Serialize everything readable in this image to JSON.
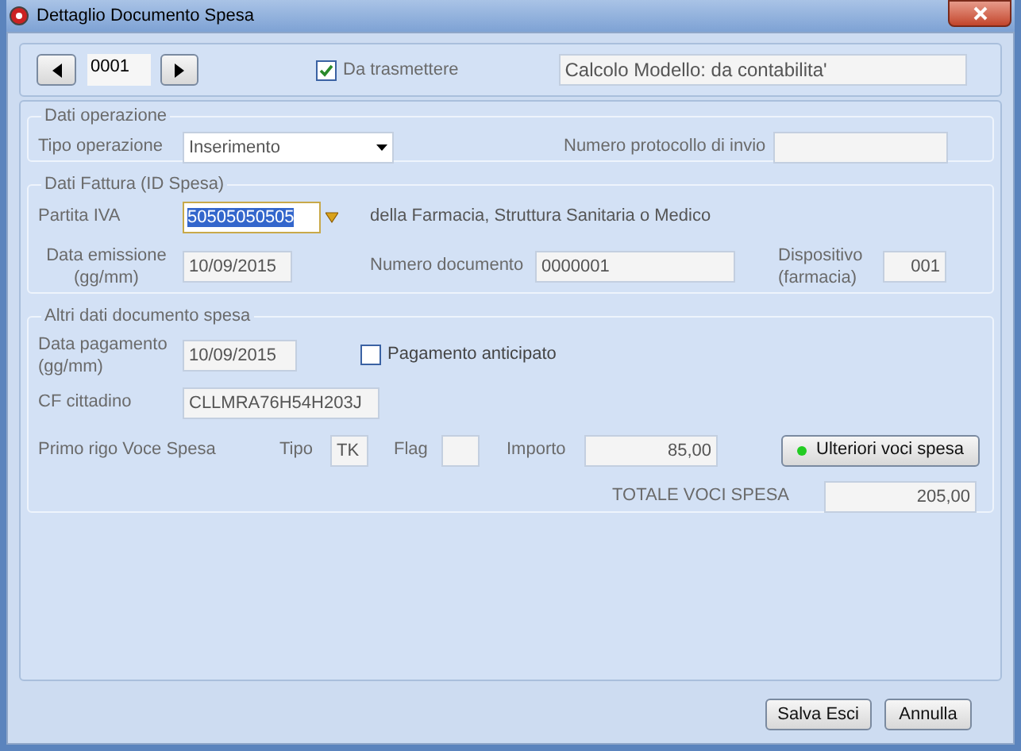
{
  "window": {
    "title": "Dettaglio Documento Spesa"
  },
  "nav": {
    "record": "0001"
  },
  "transmit": {
    "label": "Da trasmettere",
    "checked": true
  },
  "calc_mode": "Calcolo Modello: da contabilita'",
  "operation": {
    "legend": "Dati operazione",
    "type_label": "Tipo operazione",
    "type_value": "Inserimento",
    "protocol_label": "Numero protocollo di invio"
  },
  "invoice": {
    "legend": "Dati Fattura (ID Spesa)",
    "vat_label": "Partita IVA",
    "vat_value": "50505050505",
    "vat_note": "della Farmacia, Struttura Sanitaria o Medico",
    "date_label": [
      "Data emissione",
      "(gg/mm)"
    ],
    "date_value": "10/09/2015",
    "doc_label": "Numero documento",
    "doc_value": "0000001",
    "device_label": [
      "Dispositivo",
      "(farmacia)"
    ],
    "device_value": "001"
  },
  "other": {
    "legend": "Altri dati documento spesa",
    "pay_label": [
      "Data pagamento",
      "(gg/mm)"
    ],
    "pay_value": "10/09/2015",
    "advance": {
      "label": "Pagamento anticipato",
      "checked": false
    },
    "cf_label": "CF cittadino",
    "cf_value": "CLLMRA76H54H203J",
    "row_label": "Primo rigo Voce Spesa",
    "tipo_label": "Tipo",
    "tipo_value": "TK",
    "flag_label": "Flag",
    "amount_label": "Importo",
    "amount_value": "85,00",
    "more_button": "Ulteriori voci spesa",
    "total_label": "TOTALE VOCI SPESA",
    "total_value": "205,00"
  },
  "buttons": [
    "Salva Esci",
    "Annulla"
  ]
}
